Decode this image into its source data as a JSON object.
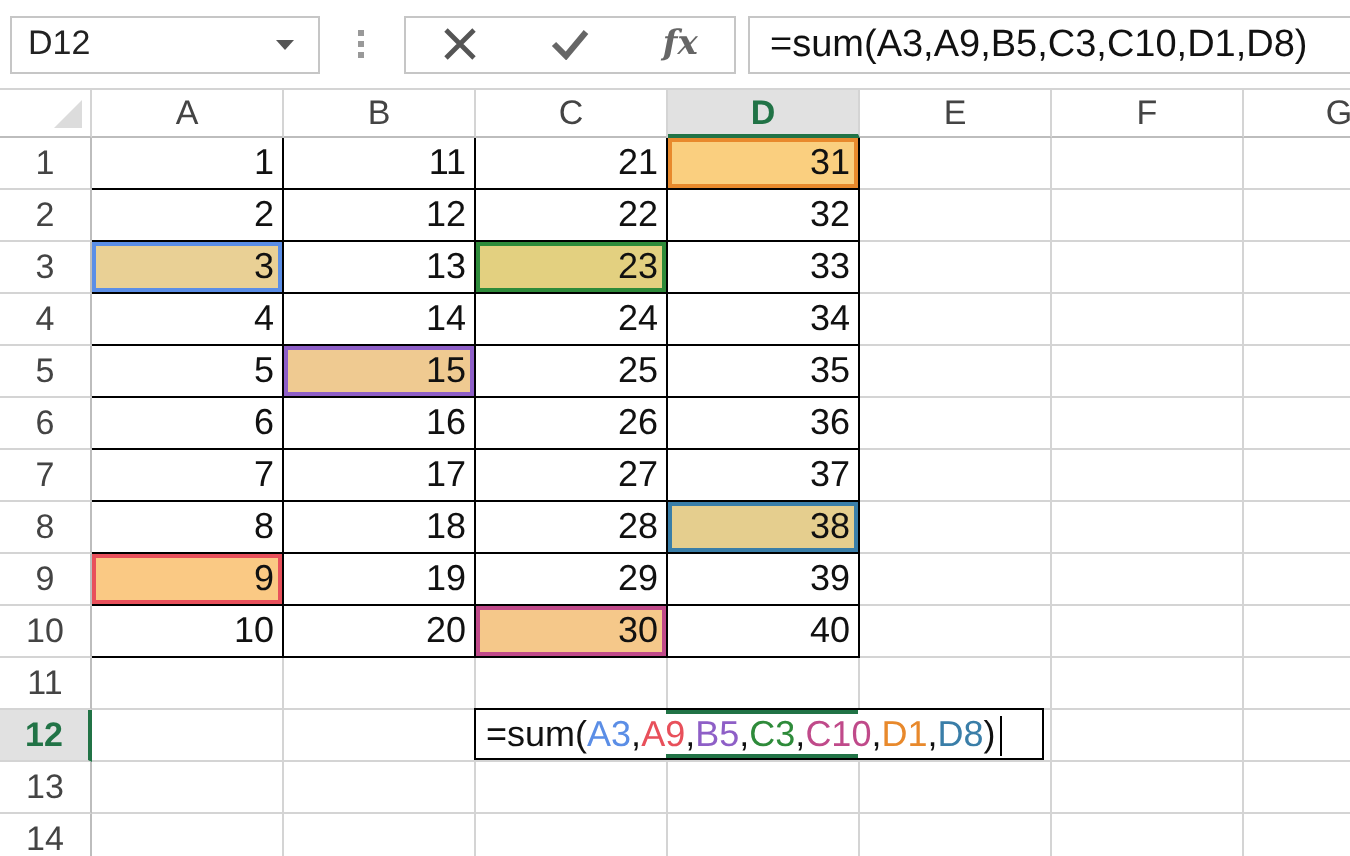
{
  "name_box": {
    "value": "D12"
  },
  "formula_bar": {
    "function_label": "fx",
    "value": "=sum(A3,A9,B5,C3,C10,D1,D8)"
  },
  "columns": [
    {
      "label": "A",
      "selected": false
    },
    {
      "label": "B",
      "selected": false
    },
    {
      "label": "C",
      "selected": false
    },
    {
      "label": "D",
      "selected": true
    },
    {
      "label": "E",
      "selected": false
    },
    {
      "label": "F",
      "selected": false
    },
    {
      "label": "G",
      "selected": false
    }
  ],
  "rows": [
    {
      "label": "1",
      "selected": false,
      "cells": [
        {
          "value": "1"
        },
        {
          "value": "11"
        },
        {
          "value": "21"
        },
        {
          "value": "31",
          "color": "#e8892c"
        }
      ]
    },
    {
      "label": "2",
      "selected": false,
      "cells": [
        {
          "value": "2"
        },
        {
          "value": "12"
        },
        {
          "value": "22"
        },
        {
          "value": "32"
        }
      ]
    },
    {
      "label": "3",
      "selected": false,
      "cells": [
        {
          "value": "3",
          "color": "#5b8ee6"
        },
        {
          "value": "13"
        },
        {
          "value": "23",
          "color": "#2e8b3a"
        },
        {
          "value": "33"
        }
      ]
    },
    {
      "label": "4",
      "selected": false,
      "cells": [
        {
          "value": "4"
        },
        {
          "value": "14"
        },
        {
          "value": "24"
        },
        {
          "value": "34"
        }
      ]
    },
    {
      "label": "5",
      "selected": false,
      "cells": [
        {
          "value": "5"
        },
        {
          "value": "15",
          "color": "#8e5fc7"
        },
        {
          "value": "25"
        },
        {
          "value": "35"
        }
      ]
    },
    {
      "label": "6",
      "selected": false,
      "cells": [
        {
          "value": "6"
        },
        {
          "value": "16"
        },
        {
          "value": "26"
        },
        {
          "value": "36"
        }
      ]
    },
    {
      "label": "7",
      "selected": false,
      "cells": [
        {
          "value": "7"
        },
        {
          "value": "17"
        },
        {
          "value": "27"
        },
        {
          "value": "37"
        }
      ]
    },
    {
      "label": "8",
      "selected": false,
      "cells": [
        {
          "value": "8"
        },
        {
          "value": "18"
        },
        {
          "value": "28"
        },
        {
          "value": "38",
          "color": "#3a7ea8"
        }
      ]
    },
    {
      "label": "9",
      "selected": false,
      "cells": [
        {
          "value": "9",
          "color": "#e8505b"
        },
        {
          "value": "19"
        },
        {
          "value": "29"
        },
        {
          "value": "39"
        }
      ]
    },
    {
      "label": "10",
      "selected": false,
      "cells": [
        {
          "value": "10"
        },
        {
          "value": "20"
        },
        {
          "value": "30",
          "color": "#c04a8a"
        },
        {
          "value": "40"
        }
      ]
    },
    {
      "label": "11",
      "selected": false
    },
    {
      "label": "12",
      "selected": true,
      "editor": {
        "tokens": [
          {
            "kind": "plain",
            "text": "=sum("
          },
          {
            "kind": "ref",
            "text": "A3",
            "color": "#5b8ee6"
          },
          {
            "kind": "plain",
            "text": ","
          },
          {
            "kind": "ref",
            "text": "A9",
            "color": "#e8505b"
          },
          {
            "kind": "plain",
            "text": ","
          },
          {
            "kind": "ref",
            "text": "B5",
            "color": "#8e5fc7"
          },
          {
            "kind": "plain",
            "text": ","
          },
          {
            "kind": "ref",
            "text": "C3",
            "color": "#2e8b3a"
          },
          {
            "kind": "plain",
            "text": ","
          },
          {
            "kind": "ref",
            "text": "C10",
            "color": "#c04a8a"
          },
          {
            "kind": "plain",
            "text": ","
          },
          {
            "kind": "ref",
            "text": "D1",
            "color": "#e8892c"
          },
          {
            "kind": "plain",
            "text": ","
          },
          {
            "kind": "ref",
            "text": "D8",
            "color": "#3a7ea8"
          },
          {
            "kind": "plain",
            "text": ")"
          }
        ]
      }
    },
    {
      "label": "13",
      "selected": false
    },
    {
      "label": "14",
      "selected": false
    }
  ]
}
